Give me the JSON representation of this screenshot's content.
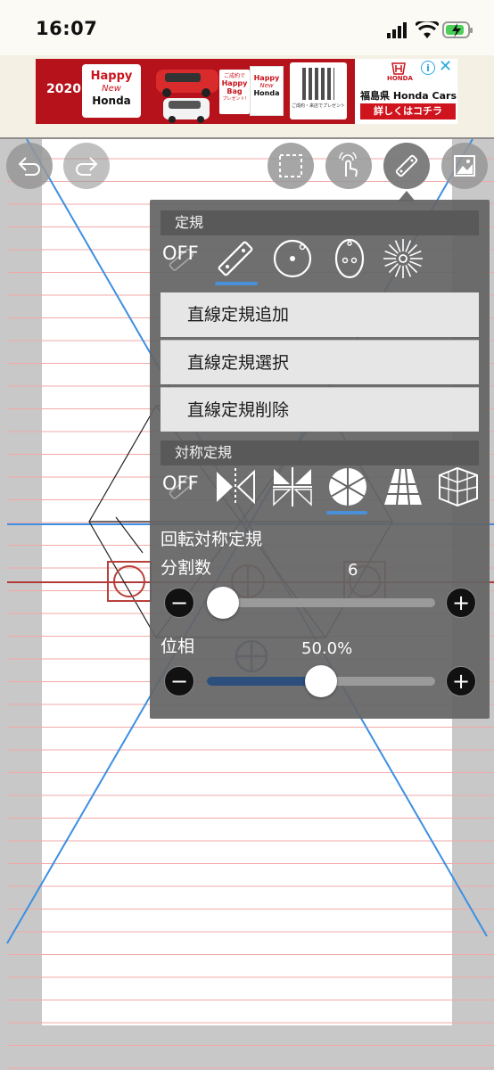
{
  "status_bar": {
    "time": "16:07"
  },
  "ad": {
    "year": "2020",
    "headline_1": "Happy",
    "headline_2": "New",
    "headline_3": "Honda",
    "bag_top": "ご成約で",
    "bag_line1": "Happy",
    "bag_line2": "Bag",
    "bag_line3": "プレゼント!",
    "bag2_line1": "Happy",
    "bag2_line2": "New",
    "bag2_line3": "Honda",
    "qr_caption": "ご成約・来店でプレゼント",
    "brand_small": "HONDA",
    "dealer": "福島県 Honda Cars",
    "cta": "詳しくはコチラ",
    "info_icon": "info-icon",
    "close_icon": "close-icon"
  },
  "toolbar": {
    "undo": "undo-icon",
    "redo": "redo-icon",
    "select": "selection-icon",
    "touch": "touch-icon",
    "ruler": "ruler-icon",
    "layer": "image-layer-icon"
  },
  "ruler_panel": {
    "section_title": "定規",
    "off_label": "OFF",
    "menu": [
      "直線定規追加",
      "直線定規選択",
      "直線定規削除"
    ],
    "symmetry_title": "対称定規",
    "symmetry_off_label": "OFF",
    "rotation_title": "回転対称定規",
    "divisions_label": "分割数",
    "divisions_value": "6",
    "divisions_fraction": 0.0,
    "phase_label": "位相",
    "phase_value": "50.0%",
    "phase_fraction": 0.5,
    "minus": "−",
    "plus": "+"
  },
  "colors": {
    "accent": "#4a90d9",
    "guide_blue": "#3c8ee0",
    "guide_red": "#c0392b",
    "ruled_line": "#f0a0a0"
  }
}
